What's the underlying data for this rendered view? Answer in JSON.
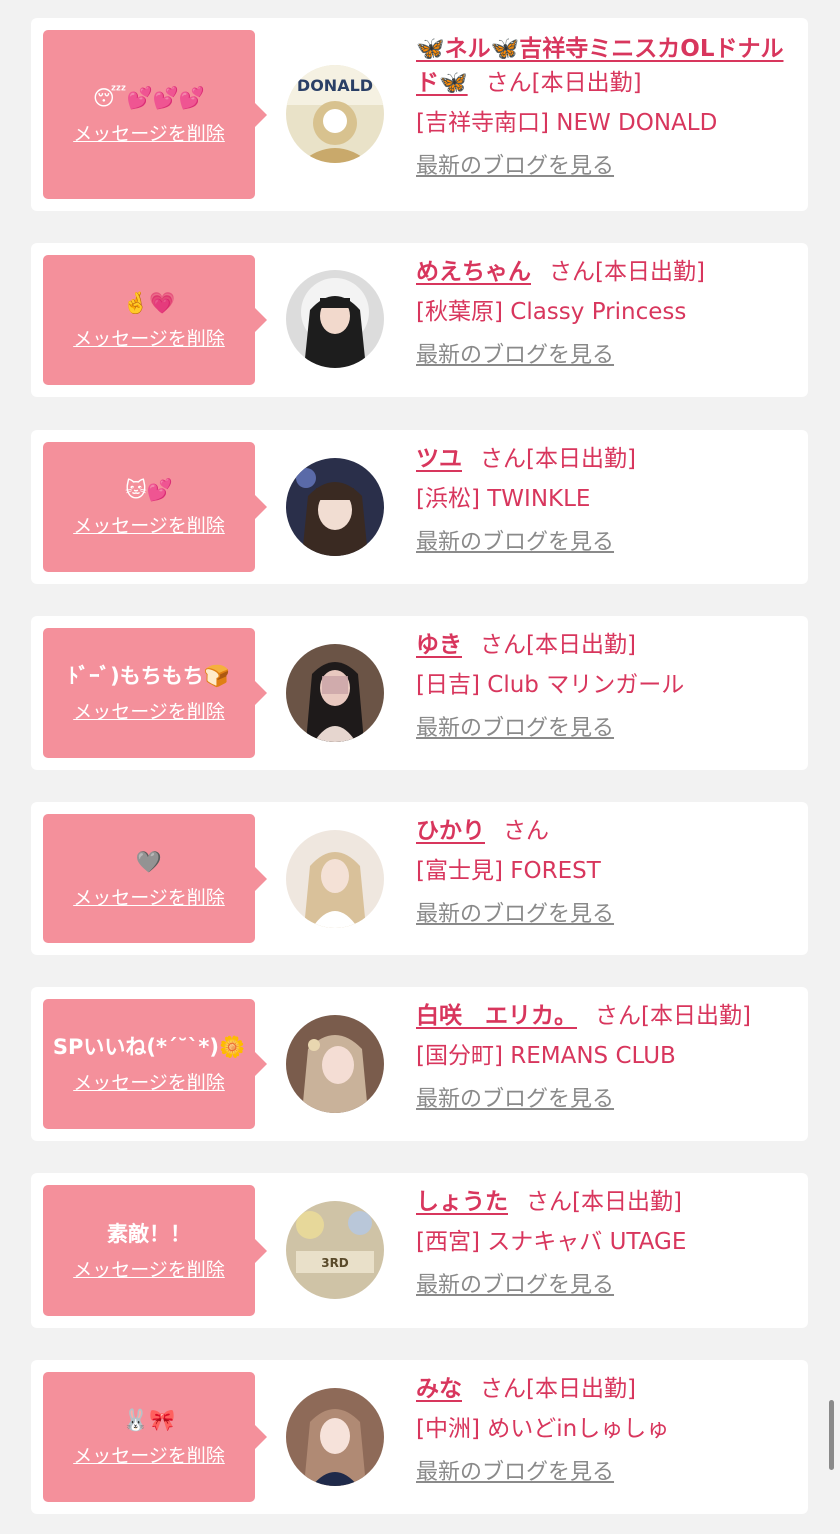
{
  "delete_label": "メッセージを削除",
  "blog_label": "最新のブログを見る",
  "san_label": "さん",
  "items": [
    {
      "message": "😴💕💕💕",
      "name": "🦋ネル🦋吉祥寺ミニスカOLドナルド🦋",
      "status": "[本日出勤]",
      "shop": "[吉祥寺南口] NEW DONALD",
      "avatar_icon": "profile-photo"
    },
    {
      "message": "🤞💗",
      "name": "めえちゃん",
      "status": "[本日出勤]",
      "shop": "[秋葉原] Classy Princess",
      "avatar_icon": "profile-photo"
    },
    {
      "message": "🐱💕",
      "name": "ツユ",
      "status": "[本日出勤]",
      "shop": "[浜松] TWINKLE",
      "avatar_icon": "profile-photo"
    },
    {
      "message": "ﾄﾞｰﾞ)もちもち🍞",
      "name": "ゆき",
      "status": "[本日出勤]",
      "shop": "[日吉] Club マリンガール",
      "avatar_icon": "profile-photo"
    },
    {
      "message": "🩶",
      "name": "ひかり",
      "status": "",
      "shop": "[富士見] FOREST",
      "avatar_icon": "profile-photo"
    },
    {
      "message": "SPいいね(*´˘`*)🌼",
      "name": "白咲　エリカ。",
      "status": "[本日出勤]",
      "shop": "[国分町] REMANS CLUB",
      "avatar_icon": "profile-photo"
    },
    {
      "message": "素敵！！",
      "name": "しょうた",
      "status": "[本日出勤]",
      "shop": "[西宮] スナキャバ UTAGE",
      "avatar_icon": "profile-photo"
    },
    {
      "message": "🐰🎀",
      "name": "みな",
      "status": "[本日出勤]",
      "shop": "[中洲] めいどinしゅしゅ",
      "avatar_icon": "profile-photo"
    }
  ],
  "colors": {
    "background": "#f2f2f2",
    "card": "#ffffff",
    "bubble": "#f4909b",
    "accent": "#d8365d",
    "link_gray": "#8a8a8a"
  }
}
